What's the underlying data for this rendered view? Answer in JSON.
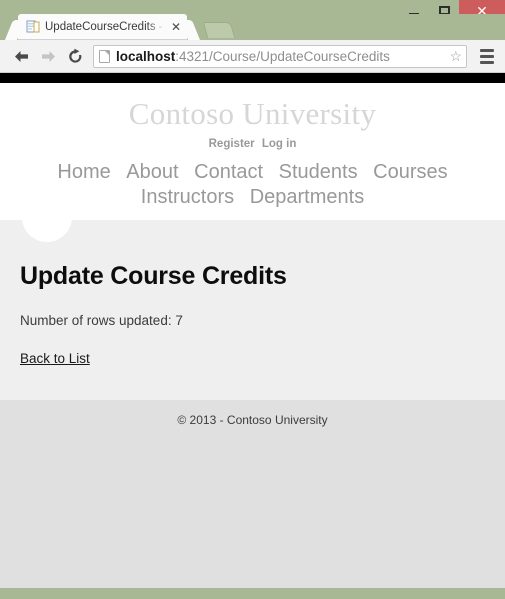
{
  "window": {
    "controls": {
      "minimize_label": "–",
      "maximize_label": "",
      "close_label": "✕"
    }
  },
  "browser": {
    "tab": {
      "title": "UpdateCourseCredits - Co",
      "close_label": "✕",
      "favicon_name": "document-favicon"
    },
    "new_tab_label": "",
    "toolbar": {
      "back_label": "←",
      "forward_label": "→",
      "reload_label": "⟳",
      "bookmark_label": "☆",
      "menu_label": ""
    },
    "address": {
      "host": "localhost",
      "path": ":4321/Course/UpdateCourseCredits",
      "full_url": "localhost:4321/Course/UpdateCourseCredits"
    }
  },
  "page": {
    "site_title": "Contoso University",
    "account_nav": [
      {
        "label": "Register"
      },
      {
        "label": "Log in"
      }
    ],
    "main_nav_line1": [
      {
        "label": "Home"
      },
      {
        "label": "About"
      },
      {
        "label": "Contact"
      },
      {
        "label": "Students"
      },
      {
        "label": "Courses"
      }
    ],
    "main_nav_line2": [
      {
        "label": "Instructors"
      },
      {
        "label": "Departments"
      }
    ],
    "heading": "Update Course Credits",
    "rows_updated_text": "Number of rows updated: 7",
    "rows_updated_count": 7,
    "back_link_label": "Back to List",
    "footer_text": "© 2013 - Contoso University"
  },
  "colors": {
    "window_frame": "#a8b894",
    "close_button": "#cd5c5c",
    "top_black_bar": "#000000",
    "site_title_gray": "#d6d6d6",
    "nav_gray": "#999999",
    "content_bg": "#efefef",
    "footer_bg": "#e0e0e0"
  }
}
